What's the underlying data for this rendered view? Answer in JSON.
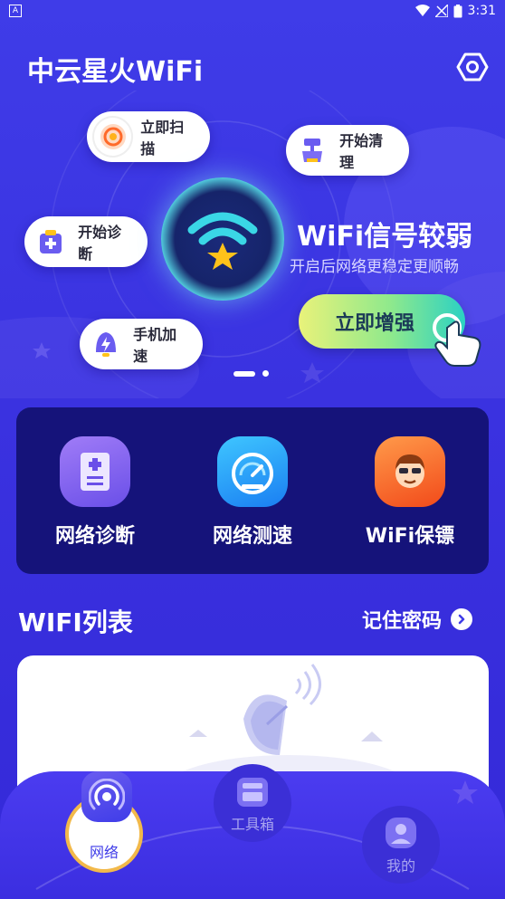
{
  "status": {
    "time": "3:31"
  },
  "app": {
    "title": "中云星火WiFi"
  },
  "hero": {
    "title": "WiFi信号较弱",
    "subtitle": "开启后网络更稳定更顺畅",
    "boost_label": "立即增强",
    "pills": {
      "scan": "立即扫描",
      "clean": "开始清理",
      "diagnose": "开始诊断",
      "speedup": "手机加速"
    }
  },
  "tools": [
    {
      "label": "网络诊断",
      "icon": "clipboard-medical-icon",
      "color": "#7b5cf0"
    },
    {
      "label": "网络测速",
      "icon": "speedometer-icon",
      "color": "#1aa6f2"
    },
    {
      "label": "WiFi保镖",
      "icon": "bodyguard-icon",
      "color": "#ff6a2a"
    }
  ],
  "wifi_list": {
    "title": "WIFI列表",
    "remember_label": "记住密码"
  },
  "nav": {
    "network": "网络",
    "toolbox": "工具箱",
    "mine": "我的"
  },
  "colors": {
    "accent": "#3f3ce8",
    "card": "#15137a",
    "boost_start": "#e9f27a",
    "boost_end": "#2bd1c3"
  }
}
